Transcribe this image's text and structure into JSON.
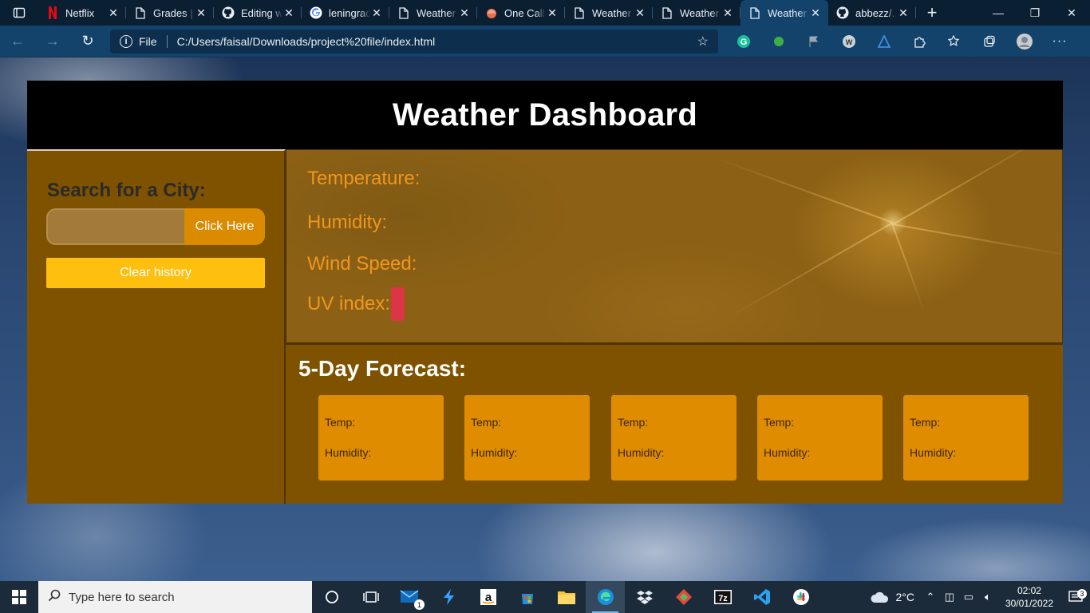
{
  "browser": {
    "tabs": [
      {
        "title": "Netflix",
        "icon": "netflix-icon"
      },
      {
        "title": "Grades | ...",
        "icon": "document-icon"
      },
      {
        "title": "Editing w...",
        "icon": "github-icon"
      },
      {
        "title": "leningrad...",
        "icon": "google-icon"
      },
      {
        "title": "Weather ...",
        "icon": "document-icon"
      },
      {
        "title": "One Call ...",
        "icon": "openweather-icon"
      },
      {
        "title": "Weather ...",
        "icon": "document-icon"
      },
      {
        "title": "Weather ...",
        "icon": "document-icon"
      },
      {
        "title": "Weather ...",
        "icon": "document-icon",
        "active": true
      },
      {
        "title": "abbezz/...",
        "icon": "github-icon"
      }
    ],
    "address": {
      "scheme_label": "File",
      "url": "C:/Users/faisal/Downloads/project%20file/index.html"
    }
  },
  "page": {
    "title": "Weather Dashboard",
    "sidebar": {
      "heading": "Search for a City:",
      "search_placeholder": "",
      "search_button": "Click Here",
      "clear_button": "Clear history"
    },
    "current": {
      "temperature_label": "Temperature:",
      "humidity_label": "Humidity:",
      "wind_label": "Wind Speed:",
      "uv_label": "UV index:"
    },
    "forecast": {
      "heading": "5-Day Forecast:",
      "cards": [
        {
          "temp_label": "Temp:",
          "humidity_label": "Humidity:"
        },
        {
          "temp_label": "Temp:",
          "humidity_label": "Humidity:"
        },
        {
          "temp_label": "Temp:",
          "humidity_label": "Humidity:"
        },
        {
          "temp_label": "Temp:",
          "humidity_label": "Humidity:"
        },
        {
          "temp_label": "Temp:",
          "humidity_label": "Humidity:"
        }
      ]
    }
  },
  "taskbar": {
    "search_placeholder": "Type here to search",
    "mail_badge": "1",
    "weather_temp": "2°C",
    "time": "02:02",
    "date": "30/01/2022",
    "notification_count": "3"
  },
  "colors": {
    "header_bg": "#000000",
    "sidebar_bg": "#7f5200",
    "accent_orange": "#e08c00",
    "clear_button": "#ffbf0f",
    "uv_badge": "#dc3545",
    "label_text": "#f0961c"
  }
}
